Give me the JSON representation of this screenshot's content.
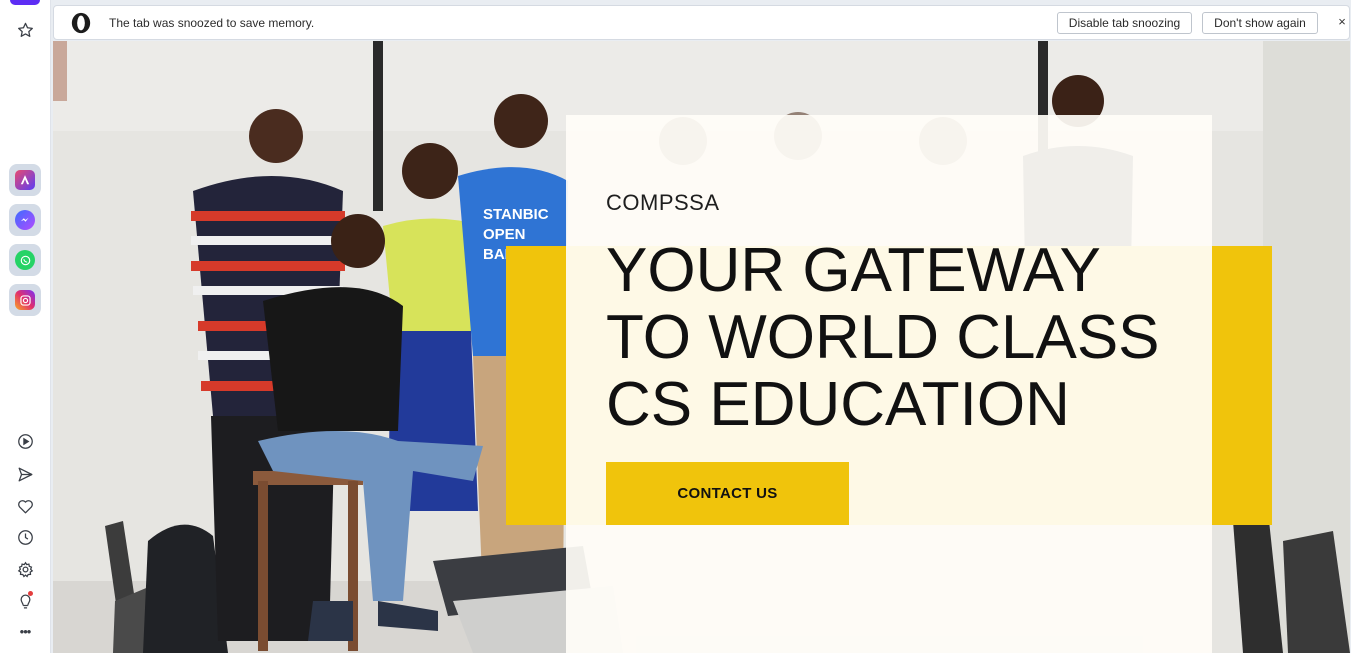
{
  "sidebar": {
    "items": [
      {
        "name": "bookmarks-icon"
      },
      {
        "name": "aria-icon"
      },
      {
        "name": "messenger-icon"
      },
      {
        "name": "whatsapp-icon"
      },
      {
        "name": "instagram-icon"
      },
      {
        "name": "player-icon"
      },
      {
        "name": "send-icon"
      },
      {
        "name": "heart-icon"
      },
      {
        "name": "history-icon"
      },
      {
        "name": "settings-icon"
      },
      {
        "name": "lightbulb-icon"
      },
      {
        "name": "more-icon"
      }
    ],
    "more_label": "•••"
  },
  "snooze_bar": {
    "message": "The tab was snoozed to save memory.",
    "disable_label": "Disable tab snoozing",
    "dont_show_label": "Don't show again",
    "close_label": "×"
  },
  "hero": {
    "kicker": "COMPSSA",
    "headline": [
      "YOUR GATEWAY",
      "TO WORLD CLASS",
      "CS EDUCATION"
    ],
    "cta_label": "CONTACT US",
    "shirt_text": [
      "STANBIC",
      "OPEN",
      "BANKING"
    ],
    "accent_color": "#f0c40c"
  },
  "colors": {
    "sidebar_accent": "#5d2df4",
    "whatsapp": "#25d366",
    "messenger": "#3b6cff",
    "instagram": "#e1306c",
    "notification": "#e33d3d"
  }
}
